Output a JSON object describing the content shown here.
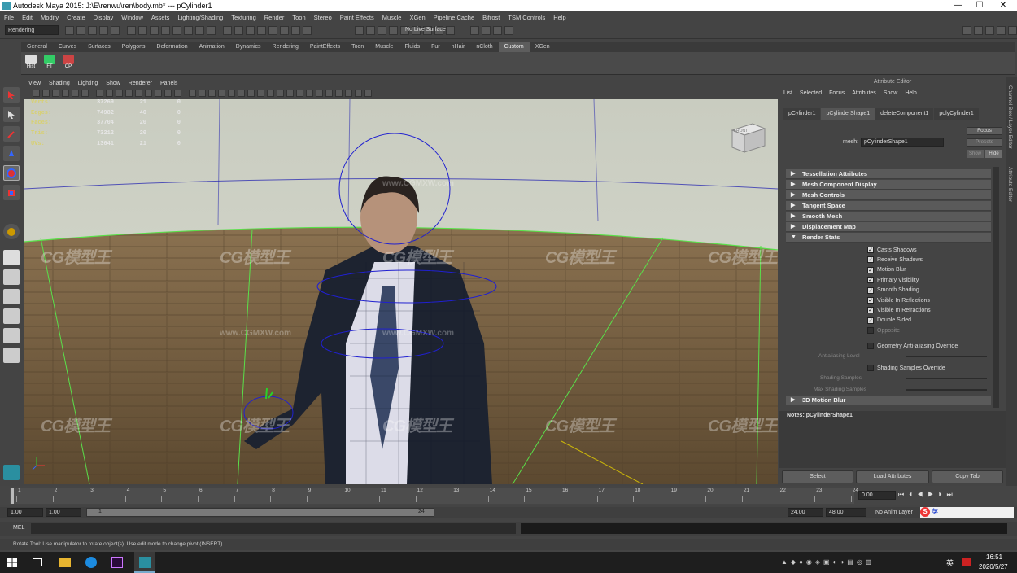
{
  "window": {
    "title": "Autodesk Maya 2015: J:\\E\\renwu\\ren\\body.mb*   ---   pCylinder1",
    "minimize": "—",
    "maximize": "☐",
    "close": "✕"
  },
  "menu": [
    "File",
    "Edit",
    "Modify",
    "Create",
    "Display",
    "Window",
    "Assets",
    "Lighting/Shading",
    "Texturing",
    "Render",
    "Toon",
    "Stereo",
    "Paint Effects",
    "Muscle",
    "XGen",
    "Pipeline Cache",
    "Bifrost",
    "TSM Controls",
    "Help"
  ],
  "status_line": {
    "mode": "Rendering",
    "live_surface": "No Live Surface"
  },
  "shelf_tabs": [
    "General",
    "Curves",
    "Surfaces",
    "Polygons",
    "Deformation",
    "Animation",
    "Dynamics",
    "Rendering",
    "PaintEffects",
    "Toon",
    "Muscle",
    "Fluids",
    "Fur",
    "nHair",
    "nCloth",
    "Custom",
    "XGen"
  ],
  "shelf_active": "Custom",
  "shelf_buttons": [
    "Hist",
    "FT",
    "CP"
  ],
  "viewport": {
    "menu": [
      "View",
      "Shading",
      "Lighting",
      "Show",
      "Renderer",
      "Panels"
    ],
    "hud": [
      {
        "label": "Verts:",
        "c1": "37269",
        "c2": "21",
        "c3": "0"
      },
      {
        "label": "Edges:",
        "c1": "74982",
        "c2": "40",
        "c3": "0"
      },
      {
        "label": "Faces:",
        "c1": "37704",
        "c2": "20",
        "c3": "0"
      },
      {
        "label": "Tris:",
        "c1": "73212",
        "c2": "20",
        "c3": "0"
      },
      {
        "label": "UVs:",
        "c1": "13641",
        "c2": "21",
        "c3": "0"
      }
    ],
    "view_cube": "FRONT",
    "watermark": "CG模型王",
    "watermark_url": "www.CGMXW.com"
  },
  "attribute_editor": {
    "title": "Attribute Editor",
    "menu": [
      "List",
      "Selected",
      "Focus",
      "Attributes",
      "Show",
      "Help"
    ],
    "tabs": [
      "pCylinder1",
      "pCylinderShape1",
      "deleteComponent1",
      "polyCylinder1"
    ],
    "active_tab": "pCylinderShape1",
    "mesh_label": "mesh:",
    "mesh_value": "pCylinderShape1",
    "focus": "Focus",
    "presets": "Presets",
    "show": "Show",
    "hide": "Hide",
    "sections": [
      "Tessellation Attributes",
      "Mesh Component Display",
      "Mesh Controls",
      "Tangent Space",
      "Smooth Mesh",
      "Displacement Map",
      "Render Stats"
    ],
    "render_stats": [
      {
        "label": "Casts Shadows",
        "checked": true
      },
      {
        "label": "Receive Shadows",
        "checked": true
      },
      {
        "label": "Motion Blur",
        "checked": true
      },
      {
        "label": "Primary Visibility",
        "checked": true
      },
      {
        "label": "Smooth Shading",
        "checked": true
      },
      {
        "label": "Visible In Reflections",
        "checked": true
      },
      {
        "label": "Visible In Refractions",
        "checked": true
      },
      {
        "label": "Double Sided",
        "checked": true
      },
      {
        "label": "Opposite",
        "checked": false
      }
    ],
    "geo_aa": "Geometry Anti-aliasing Override",
    "aa_level": "Antialiasing Level",
    "shading_override": "Shading Samples Override",
    "shading_samples": "Shading Samples",
    "max_shading_samples": "Max Shading Samples",
    "motion_blur_section": "3D Motion Blur",
    "notes": "Notes:  pCylinderShape1",
    "buttons": [
      "Select",
      "Load Attributes",
      "Copy Tab"
    ],
    "side_tabs": [
      "Channel Box / Layer Editor",
      "Attribute Editor"
    ]
  },
  "timeline": {
    "ticks": [
      "1",
      "2",
      "3",
      "4",
      "5",
      "6",
      "7",
      "8",
      "9",
      "10",
      "11",
      "12",
      "13",
      "14",
      "15",
      "16",
      "17",
      "18",
      "19",
      "20",
      "21",
      "22",
      "23",
      "24"
    ],
    "current": "0.00"
  },
  "range": {
    "start": "1.00",
    "start2": "1.00",
    "slider_start": "1",
    "slider_end": "24",
    "end": "24.00",
    "end2": "48.00",
    "anim_layer": "No Anim Layer"
  },
  "command": {
    "label": "MEL"
  },
  "help_line": "Rotate Tool: Use manipulator to rotate object(s). Use edit mode to change pivot (INSERT).",
  "taskbar": {
    "time": "16:51",
    "date": "2020/5/27",
    "ime": "英"
  }
}
